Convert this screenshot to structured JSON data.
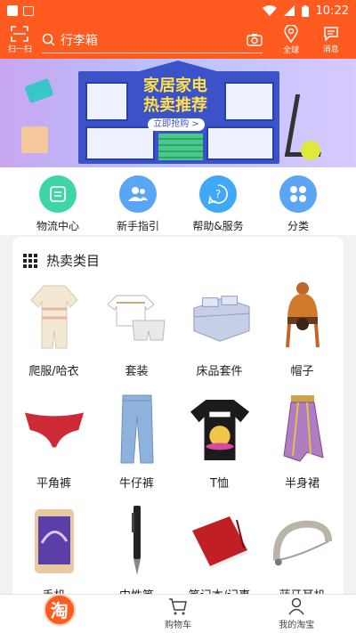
{
  "status_bar": {
    "time": "10:22"
  },
  "header": {
    "scan_label": "扫一扫",
    "search_placeholder": "行李箱",
    "globe_label": "全球",
    "message_label": "消息"
  },
  "banner": {
    "headline_line1": "家居家电",
    "headline_line2": "热卖推荐",
    "cta": "立即抢购 >"
  },
  "quick_menu": [
    {
      "label": "物流中心",
      "icon": "logistics-icon",
      "color": "#3ed6a8"
    },
    {
      "label": "新手指引",
      "icon": "users-icon",
      "color": "#5aa6f5"
    },
    {
      "label": "帮助&服务",
      "icon": "help-icon",
      "color": "#3fa8f7"
    },
    {
      "label": "分类",
      "icon": "category-icon",
      "color": "#5aa6f5"
    }
  ],
  "hot_categories": {
    "title": "热卖类目",
    "items": [
      {
        "label": "爬服/哈衣",
        "icon": "romper-icon"
      },
      {
        "label": "套装",
        "icon": "outfit-set-icon"
      },
      {
        "label": "床品套件",
        "icon": "bedding-icon"
      },
      {
        "label": "帽子",
        "icon": "hat-icon"
      },
      {
        "label": "平角裤",
        "icon": "underwear-icon"
      },
      {
        "label": "牛仔裤",
        "icon": "jeans-icon"
      },
      {
        "label": "T恤",
        "icon": "tshirt-icon"
      },
      {
        "label": "半身裙",
        "icon": "skirt-icon"
      },
      {
        "label": "手机",
        "icon": "phone-icon"
      },
      {
        "label": "中性笔",
        "icon": "pen-icon"
      },
      {
        "label": "笔记本/记事",
        "icon": "notebook-icon"
      },
      {
        "label": "蓝牙耳机",
        "icon": "headset-icon"
      }
    ]
  },
  "tabbar": {
    "home_glyph": "淘",
    "cart_label": "购物车",
    "mine_label": "我的淘宝"
  },
  "colors": {
    "brand": "#ff5a1f"
  }
}
